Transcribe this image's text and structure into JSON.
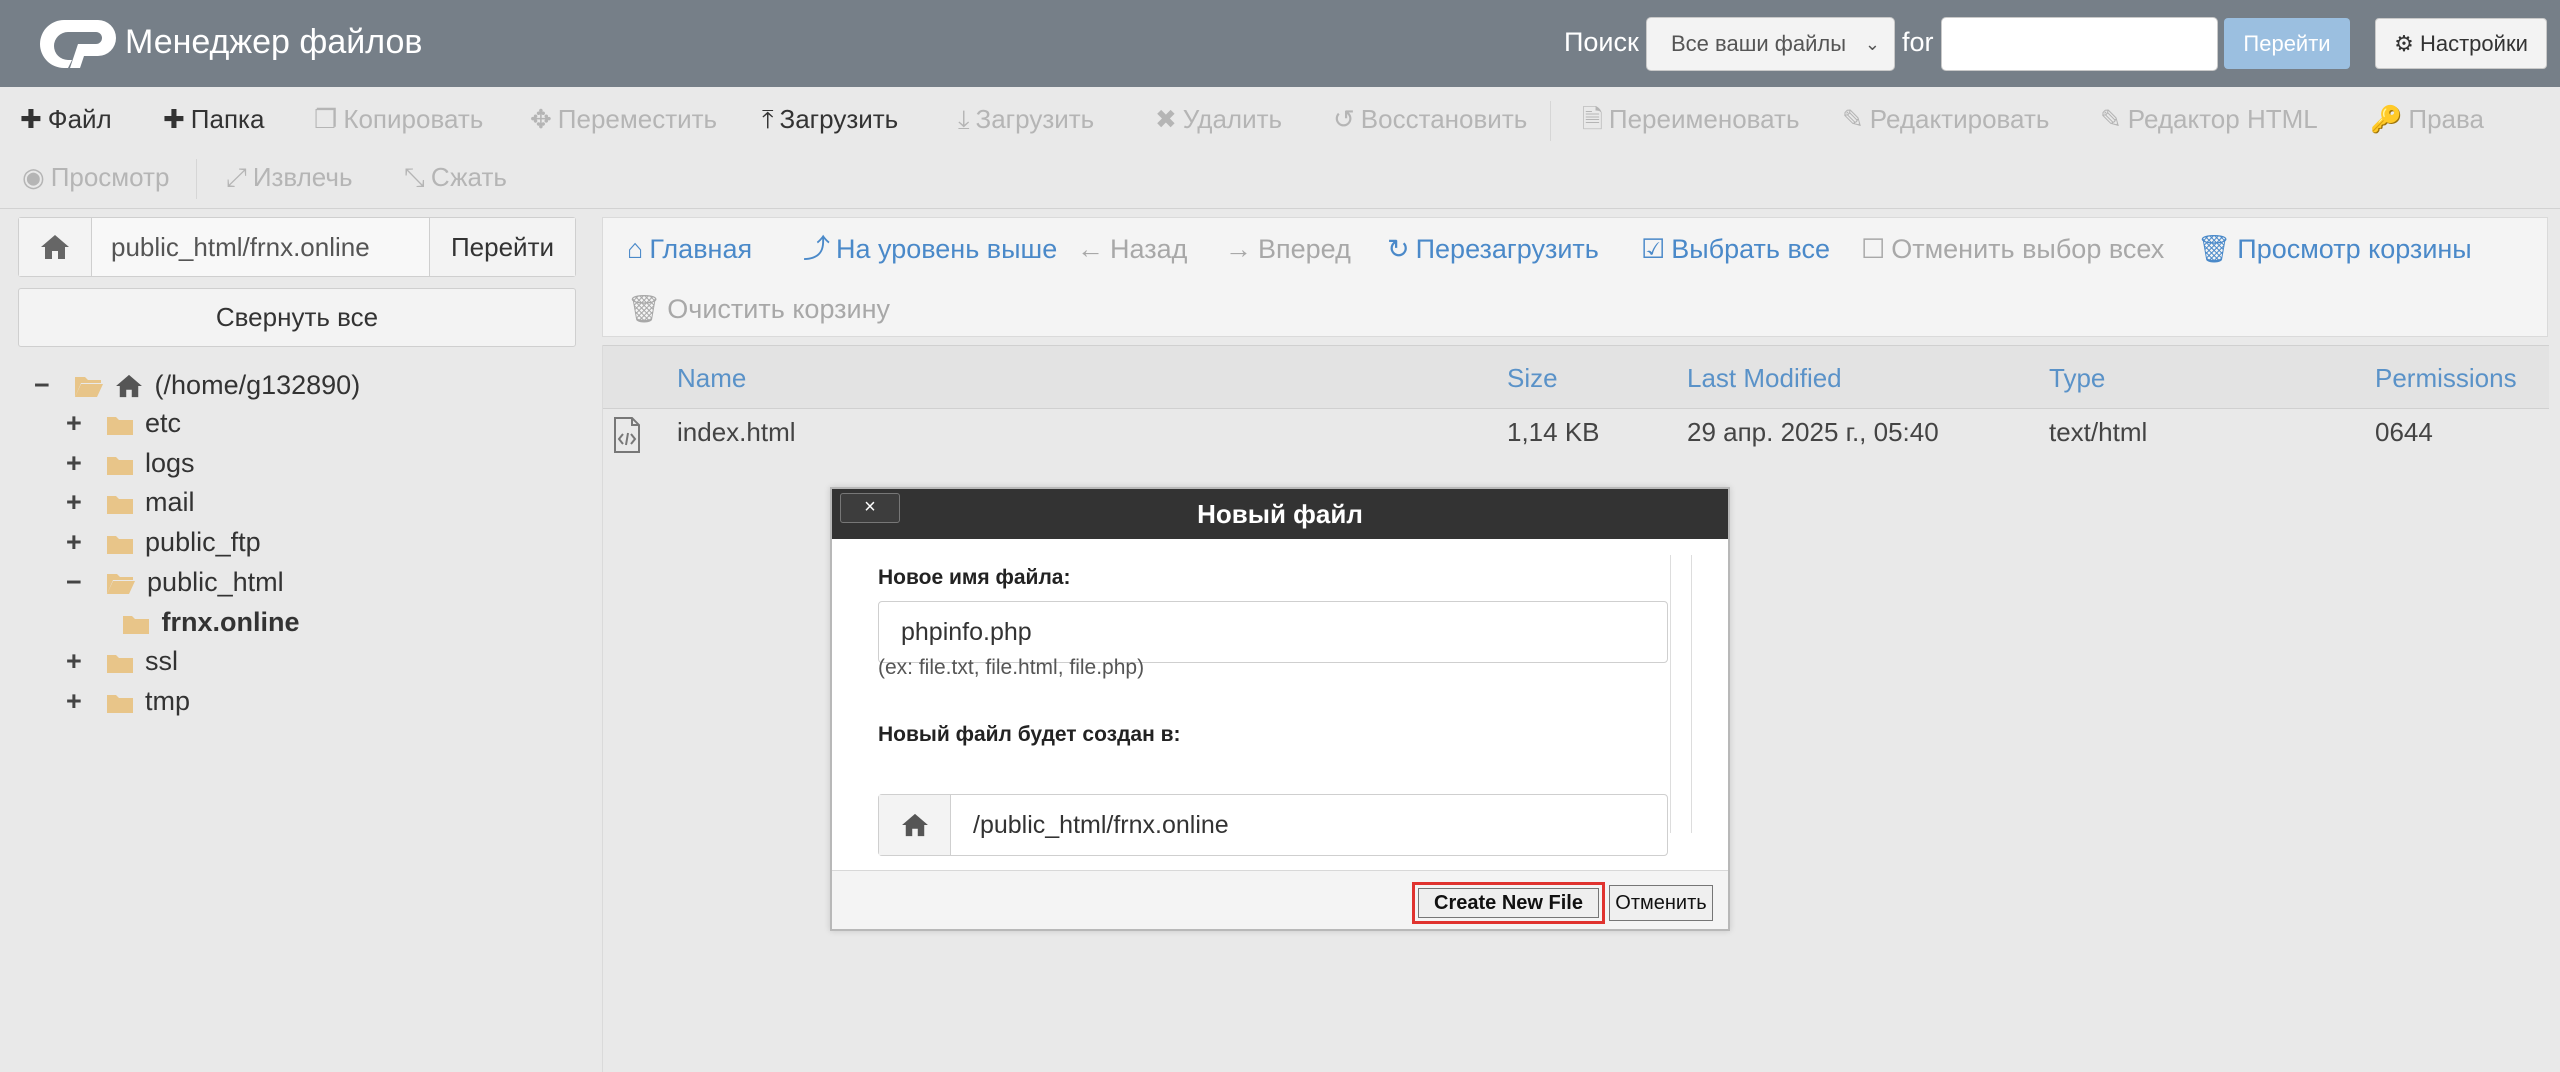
{
  "app": {
    "title": "Менеджер файлов"
  },
  "search": {
    "label": "Поиск",
    "scope": "Все ваши файлы",
    "for_label": "for",
    "query": "",
    "go": "Перейти",
    "settings": "Настройки"
  },
  "toolbar": {
    "file": "Файл",
    "folder": "Папка",
    "copy": "Копировать",
    "move": "Переместить",
    "upload": "Загрузить",
    "download": "Загрузить",
    "delete": "Удалить",
    "restore": "Восстановить",
    "rename": "Переименовать",
    "edit": "Редактировать",
    "html_editor": "Редактор HTML",
    "permissions": "Права",
    "view": "Просмотр",
    "extract": "Извлечь",
    "compress": "Сжать"
  },
  "left": {
    "path_value": "public_html/frnx.online",
    "path_go": "Перейти",
    "collapse_all": "Свернуть все",
    "tree": {
      "root": "(/home/g132890)",
      "etc": "etc",
      "logs": "logs",
      "mail": "mail",
      "public_ftp": "public_ftp",
      "public_html": "public_html",
      "frnx": "frnx.online",
      "ssl": "ssl",
      "tmp": "tmp"
    }
  },
  "nav": {
    "home": "Главная",
    "up": "На уровень выше",
    "back": "Назад",
    "forward": "Вперед",
    "reload": "Перезагрузить",
    "select_all": "Выбрать все",
    "unselect_all": "Отменить выбор всех",
    "view_trash": "Просмотр корзины",
    "empty_trash": "Очистить корзину"
  },
  "table": {
    "columns": {
      "name": "Name",
      "size": "Size",
      "modified": "Last Modified",
      "type": "Type",
      "perms": "Permissions"
    },
    "rows": [
      {
        "name": "index.html",
        "size": "1,14 KB",
        "modified": "29 апр. 2025 г., 05:40",
        "type": "text/html",
        "perms": "0644"
      }
    ]
  },
  "dialog": {
    "close": "×",
    "title": "Новый файл",
    "name_label": "Новое имя файла:",
    "name_value": "phpinfo.php",
    "hint": "(ex: file.txt, file.html, file.php)",
    "location_label": "Новый файл будет создан в:",
    "location_value": "/public_html/frnx.online",
    "create": "Create New File",
    "cancel": "Отменить"
  },
  "colors": {
    "header_bg": "#767f88",
    "link": "#4a89c9",
    "folder": "#e8c589",
    "highlight": "#e0332f"
  }
}
